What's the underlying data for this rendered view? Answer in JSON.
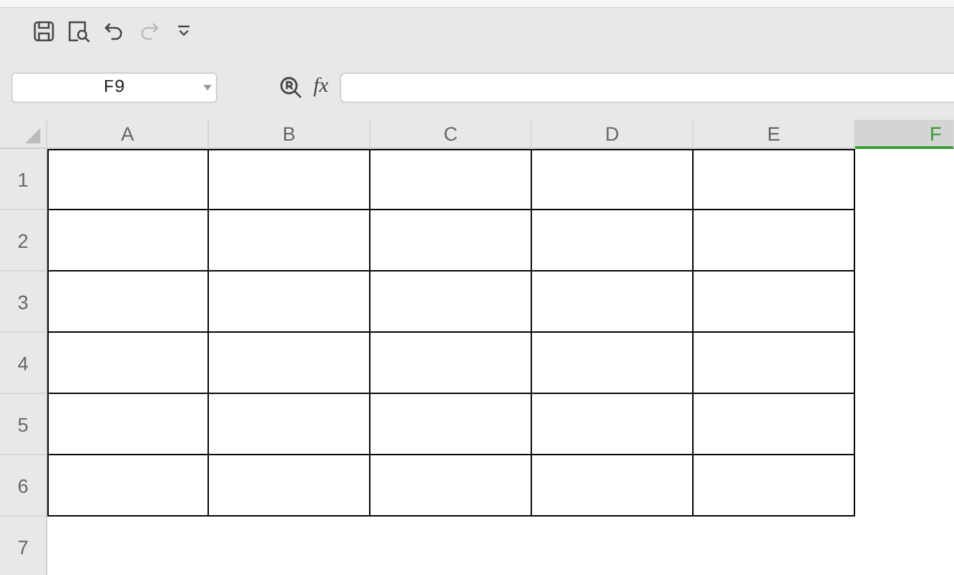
{
  "toolbar": [
    {
      "kind": "save",
      "disabled": false
    },
    {
      "kind": "preview",
      "disabled": false
    },
    {
      "kind": "undo",
      "disabled": false
    },
    {
      "kind": "redo",
      "disabled": true
    },
    {
      "kind": "more",
      "disabled": false
    }
  ],
  "formula_bar": {
    "name_box": "F9",
    "fx_label": "fx"
  },
  "columns": [
    {
      "label": "A",
      "selected": false
    },
    {
      "label": "B",
      "selected": false
    },
    {
      "label": "C",
      "selected": false
    },
    {
      "label": "D",
      "selected": false
    },
    {
      "label": "E",
      "selected": false
    },
    {
      "label": "F",
      "selected": true
    }
  ],
  "rows": [
    {
      "label": "1",
      "bordered": true
    },
    {
      "label": "2",
      "bordered": true
    },
    {
      "label": "3",
      "bordered": true
    },
    {
      "label": "4",
      "bordered": true
    },
    {
      "label": "5",
      "bordered": true
    },
    {
      "label": "6",
      "bordered": true
    },
    {
      "label": "7",
      "bordered": false
    }
  ]
}
